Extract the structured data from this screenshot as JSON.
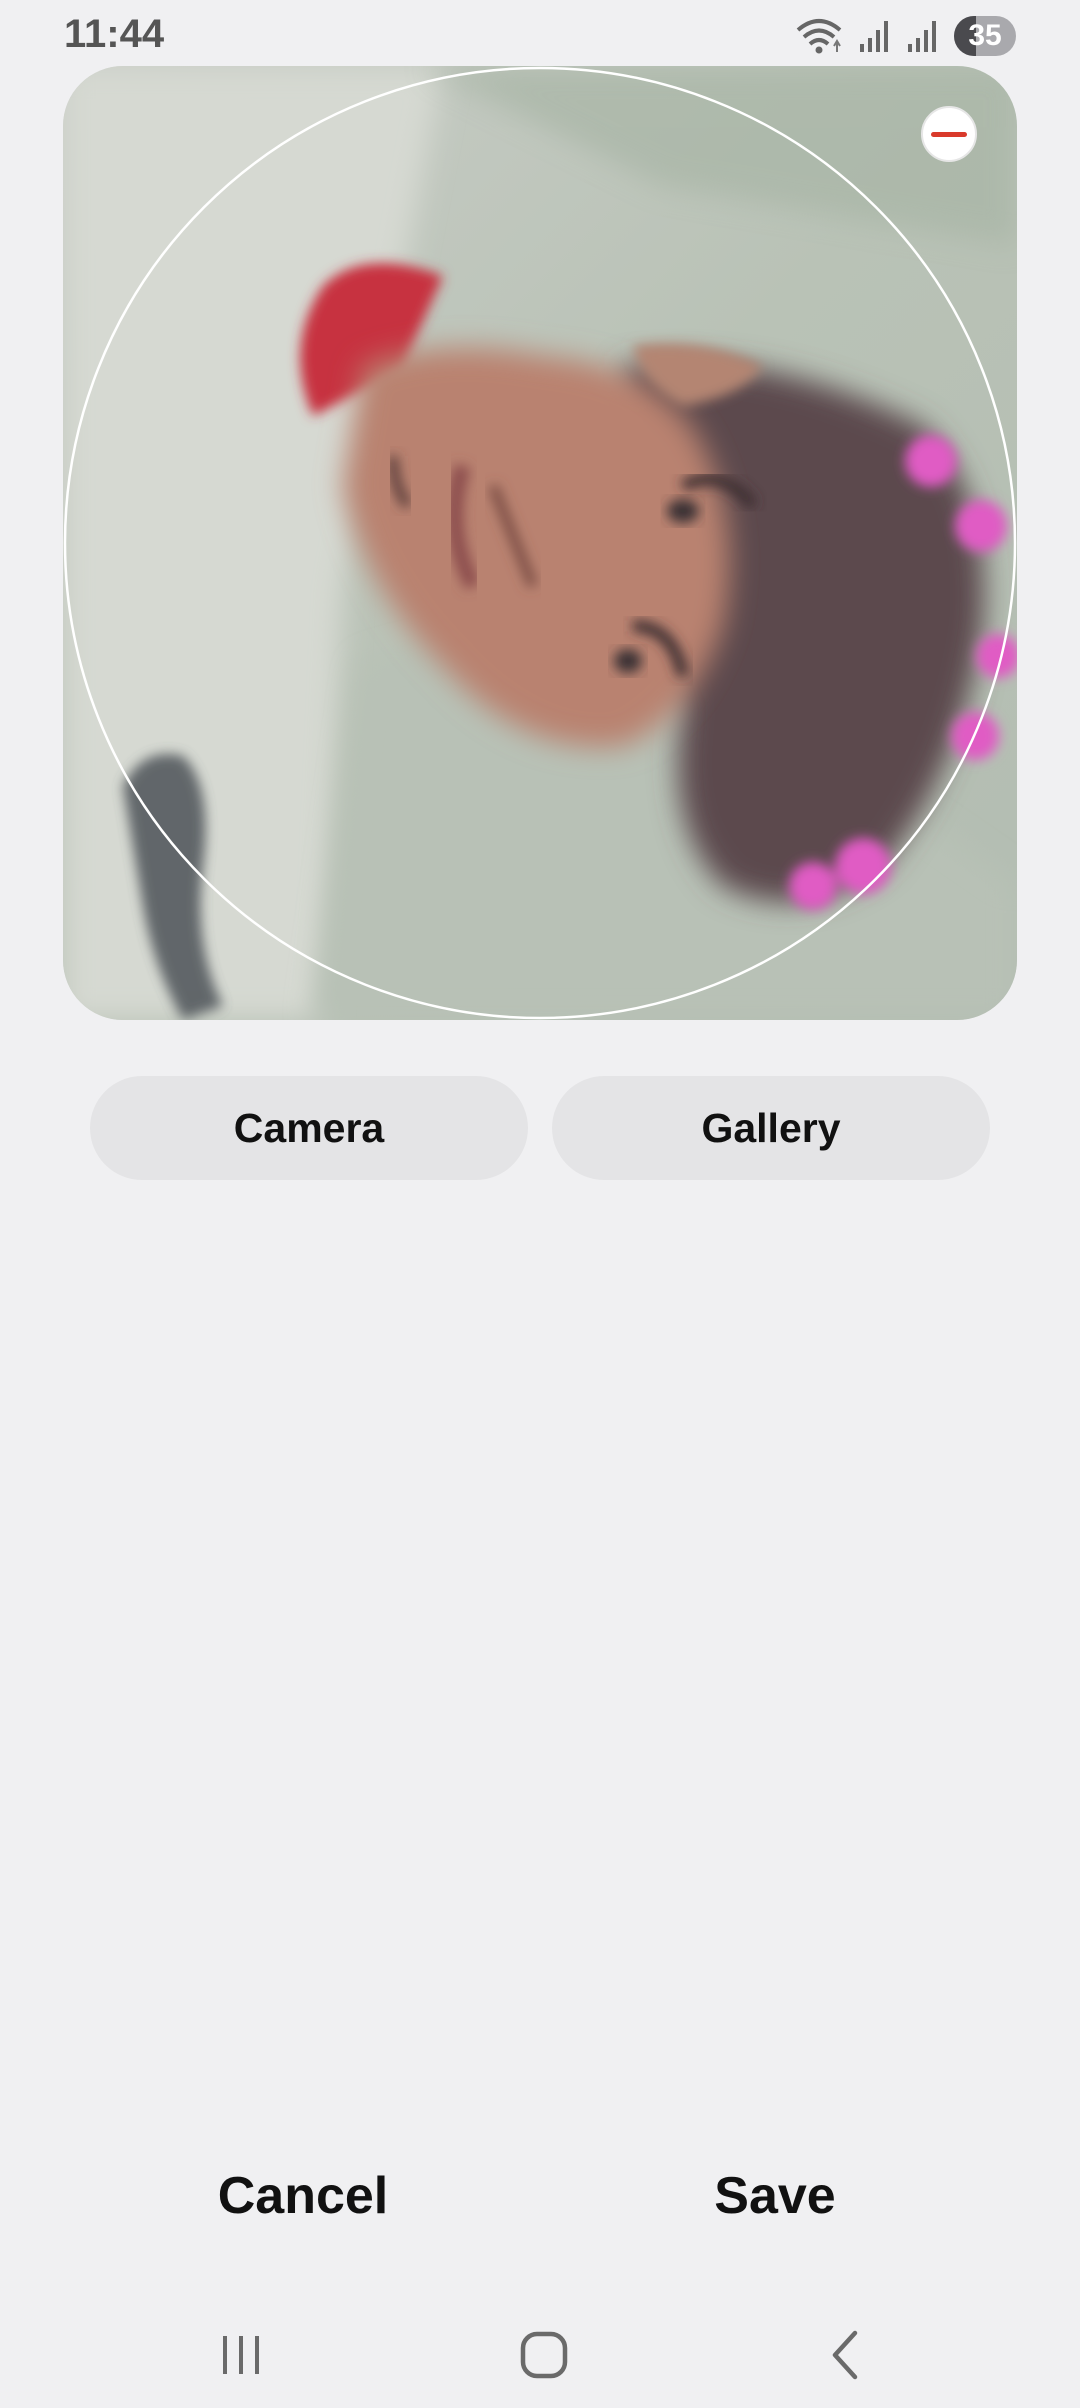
{
  "status_bar": {
    "time": "11:44",
    "battery_level": "35",
    "battery_fraction": 0.35,
    "icons": [
      "wifi-icon",
      "signal-icon",
      "signal-icon",
      "battery-icon"
    ]
  },
  "photo": {
    "description_icon": "profile-photo",
    "remove_icon": "remove-icon"
  },
  "buttons": {
    "camera": "Camera",
    "gallery": "Gallery"
  },
  "actions": {
    "cancel": "Cancel",
    "save": "Save"
  },
  "nav": {
    "icons": [
      "recents-icon",
      "home-icon",
      "back-icon"
    ]
  },
  "colors": {
    "background": "#f0f0f2",
    "button_bg": "#e4e4e6",
    "remove_accent": "#d93a2b"
  }
}
